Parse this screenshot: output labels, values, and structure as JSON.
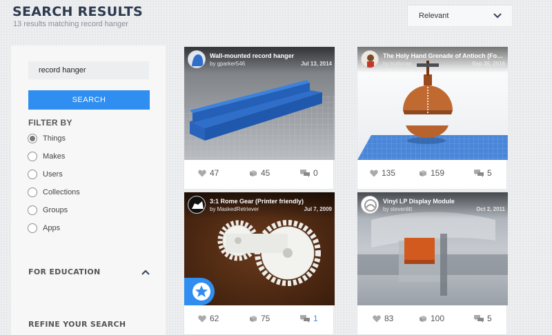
{
  "page": {
    "title": "SEARCH RESULTS",
    "subtitle": "13 results matching record hanger"
  },
  "sort": {
    "selected": "Relevant"
  },
  "sidebar": {
    "search_value": "record hanger",
    "search_button": "SEARCH",
    "filter_heading": "FILTER BY",
    "filters": [
      {
        "label": "Things",
        "checked": true
      },
      {
        "label": "Makes",
        "checked": false
      },
      {
        "label": "Users",
        "checked": false
      },
      {
        "label": "Collections",
        "checked": false
      },
      {
        "label": "Groups",
        "checked": false
      },
      {
        "label": "Apps",
        "checked": false
      }
    ],
    "education_heading": "FOR EDUCATION",
    "refine_heading": "REFINE YOUR SEARCH"
  },
  "results": [
    {
      "title": "Wall-mounted record hanger",
      "author": "by gparker546",
      "date": "Jul 13, 2014",
      "likes": "47",
      "collects": "45",
      "comments": "0"
    },
    {
      "title": "The Holy Hand Grenade of Antioch (For Record Hanger)",
      "author": "by truthman",
      "date": "Sep 26, 2016",
      "likes": "135",
      "collects": "159",
      "comments": "5"
    },
    {
      "title": "3:1 Rome Gear (Printer friendly)",
      "author": "by MaskedRetriever",
      "date": "Jul 7, 2009",
      "likes": "62",
      "collects": "75",
      "comments": "1",
      "featured": true
    },
    {
      "title": "Vinyl LP Display Module",
      "author": "by stevenlitt",
      "date": "Oct 2, 2011",
      "likes": "83",
      "collects": "100",
      "comments": "5"
    }
  ],
  "colors": {
    "accent": "#2f8ef0",
    "title": "#2d3a4f"
  },
  "icons": [
    "chevron-down-icon",
    "chevron-up-icon",
    "heart-icon",
    "collect-icon",
    "comment-icon",
    "featured-star-icon"
  ]
}
